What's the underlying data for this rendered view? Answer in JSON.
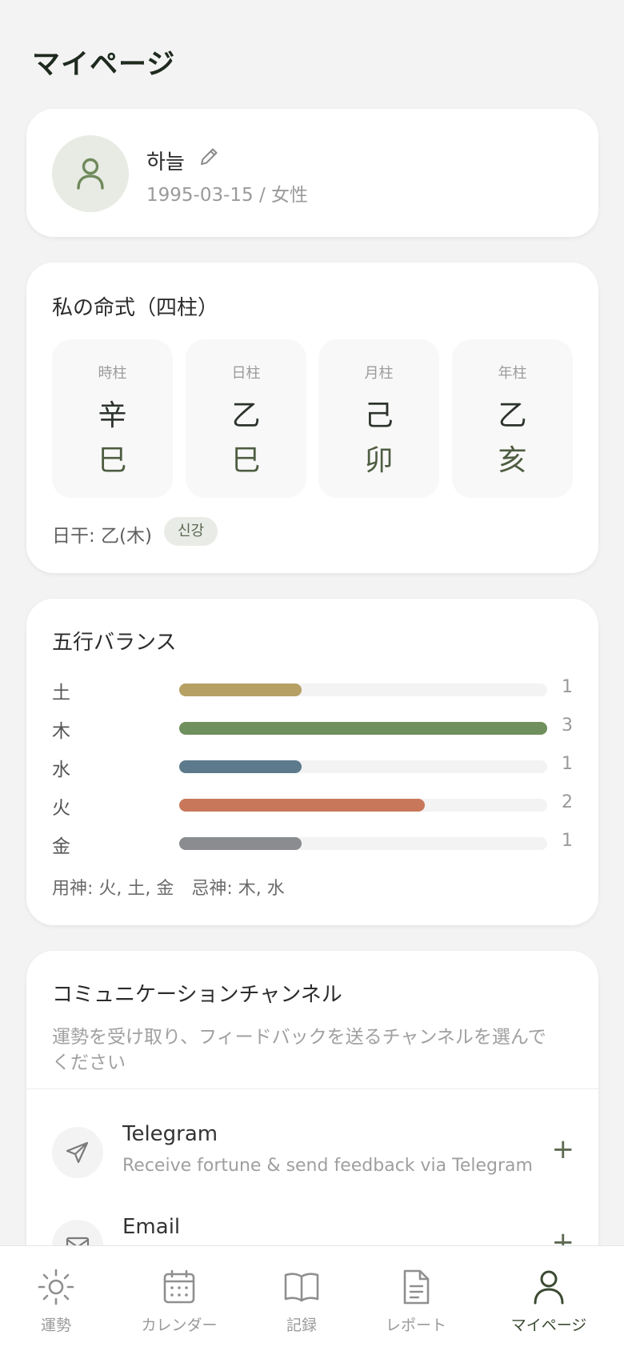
{
  "page": {
    "title": "マイページ"
  },
  "profile": {
    "name": "하늘",
    "birth_gender": "1995-03-15 / 女性"
  },
  "pillars_card": {
    "title": "私の命式（四柱）",
    "pillars": [
      {
        "label": "時柱",
        "stem": "辛",
        "branch": "巳"
      },
      {
        "label": "日柱",
        "stem": "乙",
        "branch": "巳"
      },
      {
        "label": "月柱",
        "stem": "己",
        "branch": "卯"
      },
      {
        "label": "年柱",
        "stem": "乙",
        "branch": "亥"
      }
    ],
    "day_master": "日干: 乙(木)",
    "strength_badge": "신강"
  },
  "elements_card": {
    "title": "五行バランス",
    "max": 3,
    "items": [
      {
        "name": "土",
        "count": "1",
        "value": 1,
        "color": "#b6a064"
      },
      {
        "name": "木",
        "count": "3",
        "value": 3,
        "color": "#6f8f5c"
      },
      {
        "name": "水",
        "count": "1",
        "value": 1,
        "color": "#5c7a8c"
      },
      {
        "name": "火",
        "count": "2",
        "value": 2,
        "color": "#c9775a"
      },
      {
        "name": "金",
        "count": "1",
        "value": 1,
        "color": "#8a8c90"
      }
    ],
    "yongsin": "用神: 火, 土, 金　忌神: 木, 水"
  },
  "channels_card": {
    "title": "コミュニケーションチャンネル",
    "subtitle": "運勢を受け取り、フィードバックを送るチャンネルを選んでください",
    "channels": [
      {
        "name": "Telegram",
        "description": "Receive fortune & send feedback via Telegram",
        "icon": "send-icon",
        "action": "+"
      },
      {
        "name": "Email",
        "description": "",
        "icon": "mail-icon",
        "action": "+"
      }
    ]
  },
  "bottom_nav": {
    "items": [
      {
        "label": "運勢",
        "icon": "sun-icon",
        "active": false
      },
      {
        "label": "カレンダー",
        "icon": "calendar-icon",
        "active": false
      },
      {
        "label": "記録",
        "icon": "book-icon",
        "active": false
      },
      {
        "label": "レポート",
        "icon": "document-icon",
        "active": false
      },
      {
        "label": "マイページ",
        "icon": "user-icon",
        "active": true
      }
    ]
  },
  "colors": {
    "accent": "#5d6a52",
    "background": "#f3f3f3",
    "card": "#ffffff"
  }
}
